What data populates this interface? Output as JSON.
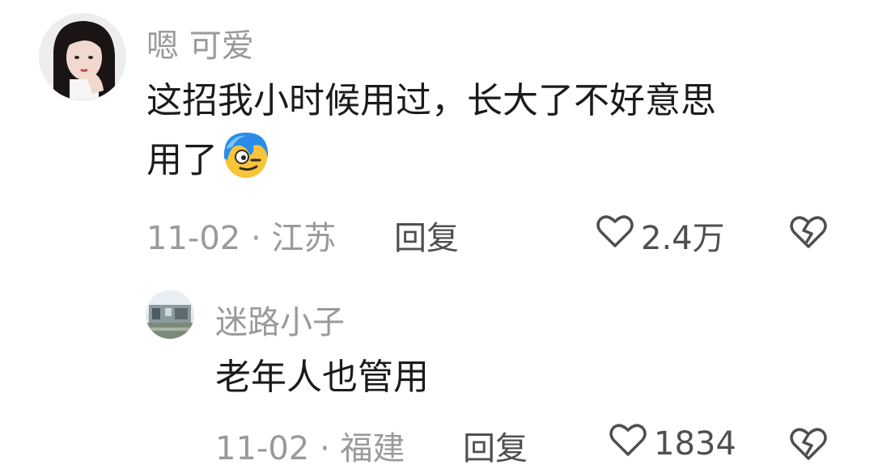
{
  "comments": [
    {
      "username": "嗯 可爱",
      "content_lines": [
        "这招我小时候用过，长大了不好意思",
        "用了"
      ],
      "inline_emoji": "blue-hair-smirk-emoji",
      "date": "11-02",
      "separator": "·",
      "location": "江苏",
      "reply_label": "回复",
      "likes": "2.4万",
      "avatar": "girl-portrait"
    },
    {
      "username": "迷路小子",
      "content": "老年人也管用",
      "date": "11-02",
      "separator": "·",
      "location": "福建",
      "reply_label": "回复",
      "likes": "1834",
      "avatar": "building-scene"
    }
  ],
  "icons": {
    "like": "heart-outline-icon",
    "dislike": "broken-heart-icon"
  },
  "colors": {
    "secondary_text": "#9a9a9a",
    "primary_text": "#1b1b1b",
    "action_text": "#4f4f4f"
  }
}
